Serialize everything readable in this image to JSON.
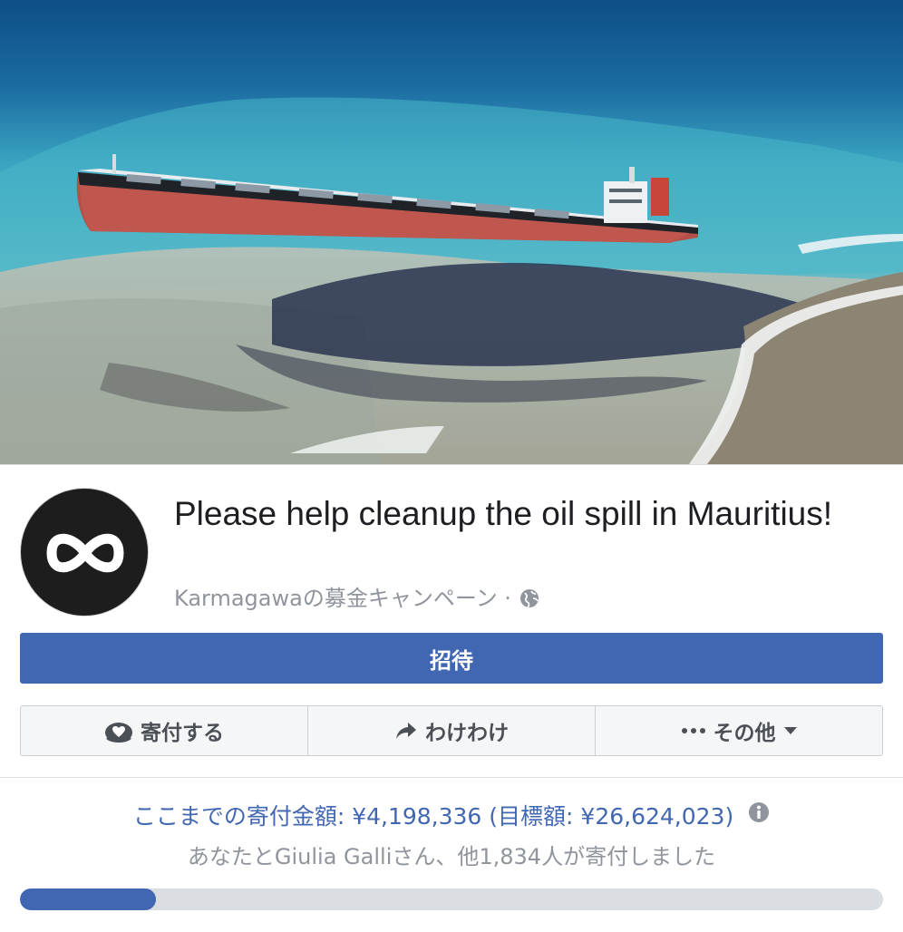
{
  "campaign": {
    "title": "Please help cleanup the oil spill in Mauritius!",
    "organizer_line": "Karmagawaの募金キャンペーン ·",
    "privacy_icon": "globe-icon",
    "avatar_icon": "infinity-logo"
  },
  "buttons": {
    "invite_label": "招待",
    "donate_label": "寄付する",
    "donate_icon": "donate-heart-icon",
    "share_label": "わけわけ",
    "share_icon": "share-arrow-icon",
    "more_label": "その他",
    "more_icon": "ellipsis-icon",
    "more_caret_icon": "caret-down-icon"
  },
  "funding": {
    "raised_text": "ここまでの寄付金額: ¥4,198,336 (目標額: ¥26,624,023)",
    "donors_text": "あなたとGiulia Galliさん、他1,834人が寄付しました",
    "progress_fraction": 0.158,
    "info_icon": "info-icon"
  },
  "colors": {
    "brand_blue": "#4267b2",
    "muted_text": "#90949c"
  }
}
